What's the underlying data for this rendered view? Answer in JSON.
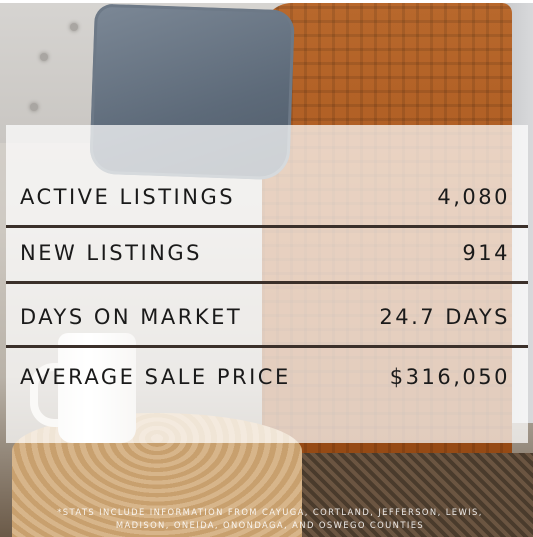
{
  "stats": [
    {
      "label": "ACTIVE LISTINGS",
      "value": "4,080"
    },
    {
      "label": "NEW LISTINGS",
      "value": "914"
    },
    {
      "label": "DAYS ON MARKET",
      "value": "24.7 DAYS"
    },
    {
      "label": "AVERAGE SALE PRICE",
      "value": "$316,050"
    }
  ],
  "footnote": {
    "line1": "*STATS INCLUDE INFORMATION FROM CAYUGA, CORTLAND, JEFFERSON, LEWIS,",
    "line2": "MADISON, ONEIDA, ONONDAGA, AND OSWEGO COUNTIES"
  },
  "colors": {
    "text": "#1a1a1a",
    "divider": "#3b302a",
    "blanket": "#a8561c",
    "pillow": "#5d6a79"
  }
}
